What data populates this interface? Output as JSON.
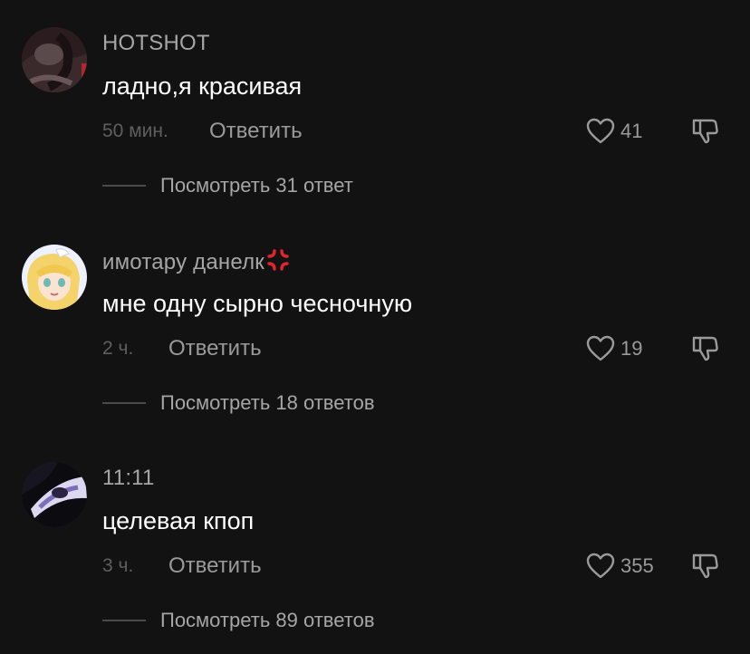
{
  "comments": [
    {
      "username": "HOTSHOT",
      "text": "ладно,я красивая",
      "time": "50 мин.",
      "reply_label": "Ответить",
      "likes": "41",
      "view_replies": "Посмотреть 31 ответ"
    },
    {
      "username": "имотару данелк",
      "username_emoji": "anger-symbol",
      "text": "мне одну сырно чесночную",
      "time": "2 ч.",
      "reply_label": "Ответить",
      "likes": "19",
      "view_replies": "Посмотреть 18 ответов"
    },
    {
      "username": "11:11",
      "text": "целевая кпоп",
      "time": "3 ч.",
      "reply_label": "Ответить",
      "likes": "355",
      "view_replies": "Посмотреть 89 ответов"
    }
  ],
  "icons": {
    "like": "heart-outline-icon",
    "dislike": "thumbs-down-outline-icon"
  },
  "colors": {
    "background": "#121212",
    "username": "#a6a6a6",
    "text": "#ffffff",
    "muted": "#5f5f5f",
    "action": "#9a9a9a",
    "anger_emoji": "#e3242b"
  }
}
